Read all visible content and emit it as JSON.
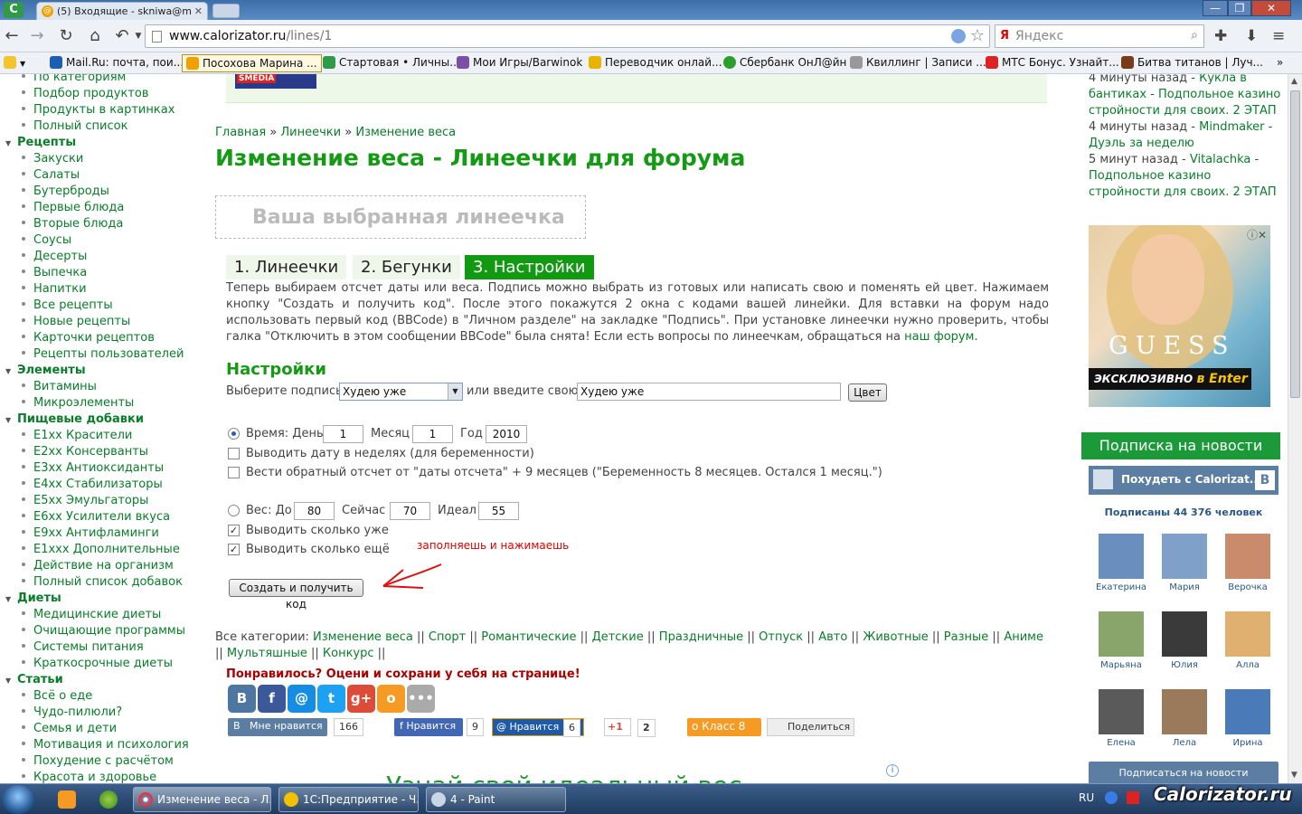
{
  "browser": {
    "tabs": [
      {
        "title": "(5) Входящие - skniwa@m"
      }
    ],
    "url_host": "www.calorizator.ru",
    "url_path": "/lines/1",
    "search_placeholder": "Яндекс",
    "bookmarks": [
      "Mail.Ru: почта, пои...",
      "Посохова Марина ...",
      "Стартовая • Личны...",
      "Мои Игры/Barwinok",
      "Переводчик онлай...",
      "Сбербанк ОнЛ@йн",
      "Квиллинг | Записи ...",
      "МТС Бонус. Узнайт...",
      "Битва титанов | Луч..."
    ],
    "bookmarks_more": "»"
  },
  "leftnav": [
    {
      "type": "item",
      "label": "По категориям"
    },
    {
      "type": "item",
      "label": "Подбор продуктов"
    },
    {
      "type": "item",
      "label": "Продукты в картинках"
    },
    {
      "type": "item",
      "label": "Полный список"
    },
    {
      "type": "cat",
      "label": "Рецепты"
    },
    {
      "type": "item",
      "label": "Закуски"
    },
    {
      "type": "item",
      "label": "Салаты"
    },
    {
      "type": "item",
      "label": "Бутерброды"
    },
    {
      "type": "item",
      "label": "Первые блюда"
    },
    {
      "type": "item",
      "label": "Вторые блюда"
    },
    {
      "type": "item",
      "label": "Соусы"
    },
    {
      "type": "item",
      "label": "Десерты"
    },
    {
      "type": "item",
      "label": "Выпечка"
    },
    {
      "type": "item",
      "label": "Напитки"
    },
    {
      "type": "item",
      "label": "Все рецепты"
    },
    {
      "type": "item",
      "label": "Новые рецепты"
    },
    {
      "type": "item",
      "label": "Карточки рецептов"
    },
    {
      "type": "item",
      "label": "Рецепты пользователей"
    },
    {
      "type": "cat",
      "label": "Элементы"
    },
    {
      "type": "item",
      "label": "Витамины"
    },
    {
      "type": "item",
      "label": "Микроэлементы"
    },
    {
      "type": "cat",
      "label": "Пищевые добавки"
    },
    {
      "type": "item",
      "label": "E1xx Красители"
    },
    {
      "type": "item",
      "label": "E2xx Консерванты"
    },
    {
      "type": "item",
      "label": "E3xx Антиоксиданты"
    },
    {
      "type": "item",
      "label": "E4xx Стабилизаторы"
    },
    {
      "type": "item",
      "label": "E5xx Эмульгаторы"
    },
    {
      "type": "item",
      "label": "E6xx Усилители вкуса"
    },
    {
      "type": "item",
      "label": "E9xx Антифламинги"
    },
    {
      "type": "item",
      "label": "E1xxx Дополнительные"
    },
    {
      "type": "item",
      "label": "Действие на организм"
    },
    {
      "type": "item",
      "label": "Полный список добавок"
    },
    {
      "type": "cat",
      "label": "Диеты"
    },
    {
      "type": "item",
      "label": "Медицинские диеты"
    },
    {
      "type": "item",
      "label": "Очищающие программы"
    },
    {
      "type": "item",
      "label": "Системы питания"
    },
    {
      "type": "item",
      "label": "Краткосрочные диеты"
    },
    {
      "type": "cat",
      "label": "Статьи"
    },
    {
      "type": "item",
      "label": "Всё о еде"
    },
    {
      "type": "item",
      "label": "Чудо-пилюли?"
    },
    {
      "type": "item",
      "label": "Семья и дети"
    },
    {
      "type": "item",
      "label": "Мотивация и психология"
    },
    {
      "type": "item",
      "label": "Похудение с расчётом"
    },
    {
      "type": "item",
      "label": "Красота и здоровье"
    }
  ],
  "main": {
    "ad_banner_text": "SMEDIA",
    "breadcrumb": {
      "home": "Главная",
      "sep": "»",
      "lines": "Линеечки",
      "current": "Изменение веса"
    },
    "title": "Изменение веса - Линеечки для форума",
    "chosen_placeholder": "Ваша выбранная линеечка",
    "tabs": [
      "1. Линеечки",
      "2. Бегунки",
      "3. Настройки"
    ],
    "description": "Теперь выбираем отсчет даты или веса. Подпись можно выбрать из готовых или написать свою и поменять ей цвет. Нажимаем кнопку \"Создать и получить код\". После этого покажутся 2 окна с кодами вашей линейки. Для вставки на форум надо использовать первый код (BBCode) в \"Личном разделе\" на закладке \"Подпись\". При установке линеечки нужно проверить, чтобы галка \"Отключить в этом сообщении BBCode\" была снята! Если есть вопросы по линеечкам, обращаться на",
    "description_link": "наш форум",
    "settings_heading": "Настройки",
    "caption_label": "Выберите подпись",
    "caption_select": "Худею уже",
    "or_enter": "или введите свою",
    "caption_input": "Худею уже",
    "color_button": "Цвет",
    "time_label": "Время: День",
    "day": "1",
    "month_label": "Месяц",
    "month": "1",
    "year_label": "Год",
    "year": "2010",
    "weeks_label": "Выводить дату в неделях (для беременности)",
    "countdown_label": "Вести обратный отсчет от \"даты отсчета\" + 9 месяцев (\"Беременность 8 месяцев. Остался 1 месяц.\")",
    "weight_label": "Вес: До",
    "weight_before": "80",
    "now_label": "Сейчас",
    "weight_now": "70",
    "ideal_label": "Идеал",
    "weight_ideal": "55",
    "show_how_much_label": "Выводить сколько уже",
    "show_how_much_more_label": "Выводить сколько ещё",
    "annotation": "заполняешь и нажимаешь",
    "create_button": "Создать и получить код",
    "all_categories_label": "Все категории:",
    "categories": [
      "Изменение веса",
      "Спорт",
      "Романтические",
      "Детские",
      "Праздничные",
      "Отпуск",
      "Авто",
      "Животные",
      "Разные",
      "Аниме",
      "Мультяшные",
      "Конкурс"
    ],
    "category_sep": "||",
    "liked": "Понравилось? Оцени и сохрани у себя на странице!",
    "likes": {
      "vk_label": "Мне нравится",
      "vk_count": "166",
      "fb_label": "Нравится",
      "fb_count": "9",
      "mail_label": "Нравится",
      "mail_count": "6",
      "gplus_label": "+1",
      "gplus_count": "2",
      "ok_label": "Класс",
      "ok_count": "8",
      "share_label": "Поделиться"
    },
    "bottom_heading": "Узнай свой идеальный вес"
  },
  "right": {
    "feed": [
      {
        "time": "4 минуты назад",
        "user": "Кукла в бантиках",
        "topic": "Подпольное казино стройности для своих. 2 ЭТАП"
      },
      {
        "time": "4 минуты назад",
        "user": "Mindmaker",
        "topic": "Дуэль за неделю"
      },
      {
        "time": "5 минут назад",
        "user": "Vitalachka",
        "topic": "Подпольное казино стройности для своих. 2 ЭТАП"
      }
    ],
    "ad_brand": "GUESS",
    "ad_tagline": "ЭКСКЛЮЗИВНО",
    "ad_store": "в Enter",
    "subscribe_bar": "Подписка на новости",
    "vk_group": "Похудеть с Calorizat...",
    "vk_letter": "В",
    "subscribers": "Подписаны 44 376 человек",
    "friends": [
      "Екатерина",
      "Мария",
      "Верочка",
      "Марьяна",
      "Юлия",
      "Алла",
      "Елена",
      "Лела",
      "Ирина"
    ],
    "vk_subscribe_button": "Подписаться на новости"
  },
  "taskbar": {
    "tasks": [
      "Изменение веса - Л...",
      "1С:Предприятие - Ч...",
      "4 - Paint"
    ],
    "lang": "RU",
    "watermark": "Calorizator.ru"
  },
  "colors": {
    "accent_green": "#159a15",
    "link_green": "#0a7d2a",
    "active_tab": "#119911",
    "annotation_red": "#dd0000"
  }
}
